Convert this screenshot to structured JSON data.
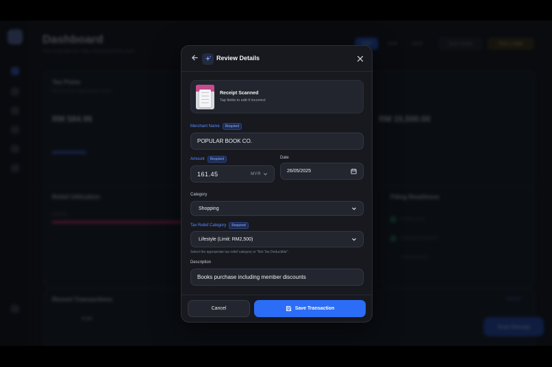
{
  "background": {
    "title": "Dashboard",
    "subtitle": "Your overview for Year of Assessment 2025",
    "top_buttons": [
      "2025",
      "2024",
      "2023",
      "Sync Email",
      "Pick a date"
    ],
    "tax_pulse": {
      "title": "Tax Pulse",
      "desc": "Real-time tax optimization status",
      "amount": "RM 584.96",
      "right_amount": "RM 15,500.00"
    },
    "relief": {
      "title": "Relief Utilization",
      "item": "Lifestyle"
    },
    "filing": {
      "title": "Filing Readiness",
      "items": [
        "Profile setup",
        "Evidence Collected",
        "Submit Return"
      ]
    },
    "recent": {
      "title": "Recent Transactions",
      "view_all": "View all",
      "item": "Grab"
    },
    "fab_label": "Scan Receipt"
  },
  "modal": {
    "title": "Review Details",
    "receipt": {
      "title": "Receipt Scanned",
      "subtitle": "Tap fields to edit if incorrect"
    },
    "merchant": {
      "label": "Merchant Name",
      "required": "Required",
      "value": "POPULAR BOOK CO."
    },
    "amount": {
      "label": "Amount",
      "required": "Required",
      "value": "161.45",
      "currency": "MYR"
    },
    "date": {
      "label": "Date",
      "value": "26/05/2025"
    },
    "category": {
      "label": "Category",
      "value": "Shopping"
    },
    "relief_category": {
      "label": "Tax Relief Category",
      "required": "Required",
      "value": "Lifestyle (Limit: RM2,500)",
      "hint": "Select the appropriate tax relief category or \"Not Tax Deductible\"."
    },
    "description": {
      "label": "Description",
      "value": "Books purchase including member discounts"
    },
    "cancel_label": "Cancel",
    "save_label": "Save Transaction"
  },
  "colors": {
    "accent": "#2b6df6",
    "required_text": "#8fb0ff"
  },
  "icons": [
    "back-arrow-icon",
    "sparkle-icon",
    "close-icon",
    "chevron-down-icon",
    "calendar-icon",
    "save-icon"
  ]
}
